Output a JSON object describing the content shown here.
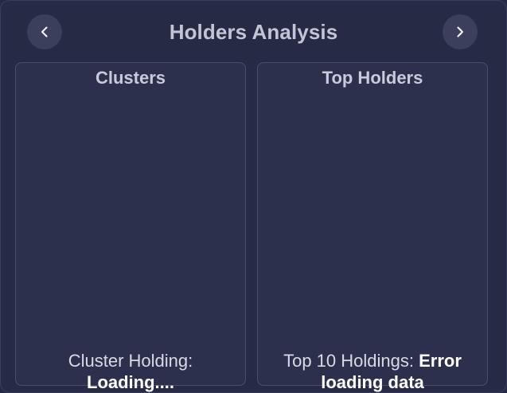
{
  "header": {
    "title": "Holders Analysis",
    "prev_icon": "chevron-left-icon",
    "next_icon": "chevron-right-icon"
  },
  "panels": {
    "clusters": {
      "title": "Clusters",
      "footer_label": "Cluster Holding: ",
      "footer_value": "Loading...."
    },
    "top_holders": {
      "title": "Top Holders",
      "footer_label": "Top 10 Holdings: ",
      "footer_value": "Error loading data"
    }
  },
  "colors": {
    "background": "#272a45",
    "panel": "#2d304c",
    "button": "#3b3f5c",
    "title_text": "#c2c5d6"
  }
}
